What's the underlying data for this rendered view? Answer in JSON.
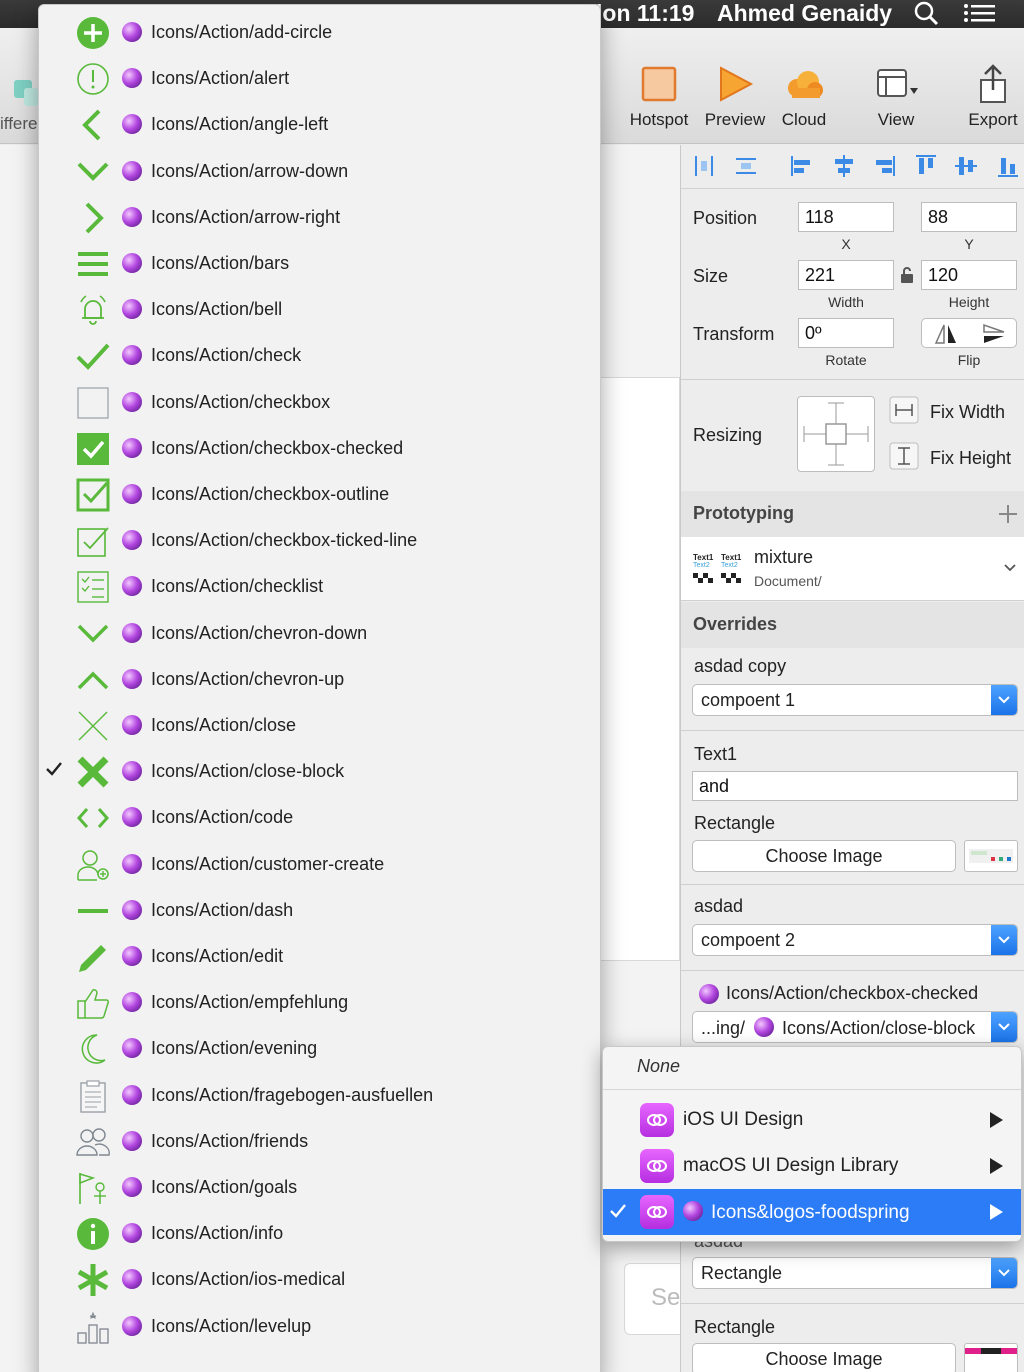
{
  "menubar": {
    "clock": "lon 11:19",
    "user": "Ahmed Genaidy"
  },
  "toolbar": {
    "left_partial_label": "iffere",
    "items": [
      {
        "label": "Hotspot",
        "icon": "hotspot-icon"
      },
      {
        "label": "Preview",
        "icon": "preview-icon"
      },
      {
        "label": "Cloud",
        "icon": "cloud-icon"
      },
      {
        "label": "View",
        "icon": "view-icon"
      },
      {
        "label": "Export",
        "icon": "export-icon"
      }
    ]
  },
  "canvas": {
    "search_placeholder": "Se"
  },
  "inspector": {
    "position": {
      "label": "Position",
      "x": "118",
      "y": "88",
      "x_label": "X",
      "y_label": "Y"
    },
    "size": {
      "label": "Size",
      "width": "221",
      "height": "120",
      "width_label": "Width",
      "height_label": "Height"
    },
    "transform": {
      "label": "Transform",
      "rotate": "0º",
      "rotate_label": "Rotate",
      "flip_label": "Flip"
    },
    "resizing": {
      "label": "Resizing",
      "fix_width": "Fix Width",
      "fix_height": "Fix Height"
    },
    "prototyping": {
      "label": "Prototyping"
    },
    "symbol": {
      "name": "mixture",
      "path": "Document/",
      "thumb_text1": "Text1",
      "thumb_text2": "Text2"
    },
    "overrides": {
      "label": "Overrides",
      "groups": [
        {
          "title": "asdad copy",
          "value": "compoent 1"
        },
        {
          "title": "Text1",
          "value": "and"
        },
        {
          "title": "Rectangle",
          "value": "Choose Image"
        },
        {
          "title": "asdad",
          "value": "compoent 2"
        },
        {
          "title": "Icons/Action/checkbox-checked",
          "value_prefix": "...ing/",
          "value": "Icons/Action/close-block"
        },
        {
          "title": "asdad",
          "value": "Rectangle"
        },
        {
          "title": "Rectangle",
          "value": "Choose Image"
        }
      ]
    }
  },
  "layer_menu": {
    "items": [
      {
        "label": "Icons/Action/add-circle",
        "icon": "add-circle-icon",
        "checked": false
      },
      {
        "label": "Icons/Action/alert",
        "icon": "alert-icon",
        "checked": false
      },
      {
        "label": "Icons/Action/angle-left",
        "icon": "angle-left-icon",
        "checked": false
      },
      {
        "label": "Icons/Action/arrow-down",
        "icon": "arrow-down-icon",
        "checked": false
      },
      {
        "label": "Icons/Action/arrow-right",
        "icon": "arrow-right-icon",
        "checked": false
      },
      {
        "label": "Icons/Action/bars",
        "icon": "bars-icon",
        "checked": false
      },
      {
        "label": "Icons/Action/bell",
        "icon": "bell-icon",
        "checked": false
      },
      {
        "label": "Icons/Action/check",
        "icon": "check-icon",
        "checked": false
      },
      {
        "label": "Icons/Action/checkbox",
        "icon": "checkbox-icon",
        "checked": false
      },
      {
        "label": "Icons/Action/checkbox-checked",
        "icon": "checkbox-checked-icon",
        "checked": false
      },
      {
        "label": "Icons/Action/checkbox-outline",
        "icon": "checkbox-outline-icon",
        "checked": false
      },
      {
        "label": "Icons/Action/checkbox-ticked-line",
        "icon": "checkbox-ticked-line-icon",
        "checked": false
      },
      {
        "label": "Icons/Action/checklist",
        "icon": "checklist-icon",
        "checked": false
      },
      {
        "label": "Icons/Action/chevron-down",
        "icon": "chevron-down-icon",
        "checked": false
      },
      {
        "label": "Icons/Action/chevron-up",
        "icon": "chevron-up-icon",
        "checked": false
      },
      {
        "label": "Icons/Action/close",
        "icon": "close-icon",
        "checked": false
      },
      {
        "label": "Icons/Action/close-block",
        "icon": "close-block-icon",
        "checked": true
      },
      {
        "label": "Icons/Action/code",
        "icon": "code-icon",
        "checked": false
      },
      {
        "label": "Icons/Action/customer-create",
        "icon": "customer-create-icon",
        "checked": false
      },
      {
        "label": "Icons/Action/dash",
        "icon": "dash-icon",
        "checked": false
      },
      {
        "label": "Icons/Action/edit",
        "icon": "edit-icon",
        "checked": false
      },
      {
        "label": "Icons/Action/empfehlung",
        "icon": "thumbs-up-icon",
        "checked": false
      },
      {
        "label": "Icons/Action/evening",
        "icon": "moon-icon",
        "checked": false
      },
      {
        "label": "Icons/Action/fragebogen-ausfuellen",
        "icon": "clipboard-icon",
        "checked": false
      },
      {
        "label": "Icons/Action/friends",
        "icon": "friends-icon",
        "checked": false
      },
      {
        "label": "Icons/Action/goals",
        "icon": "goals-icon",
        "checked": false
      },
      {
        "label": "Icons/Action/info",
        "icon": "info-icon",
        "checked": false
      },
      {
        "label": "Icons/Action/ios-medical",
        "icon": "medical-icon",
        "checked": false
      },
      {
        "label": "Icons/Action/levelup",
        "icon": "levelup-icon",
        "checked": false
      }
    ]
  },
  "library_menu": {
    "none_label": "None",
    "items": [
      {
        "label": "iOS UI Design",
        "selected": false
      },
      {
        "label": "macOS UI Design Library",
        "selected": false
      },
      {
        "label": "Icons&logos-foodspring",
        "selected": true
      }
    ]
  },
  "colors": {
    "icon_green": "#58b93a",
    "selection_blue": "#2b7cf6",
    "library_pink": "#d24ef0"
  }
}
